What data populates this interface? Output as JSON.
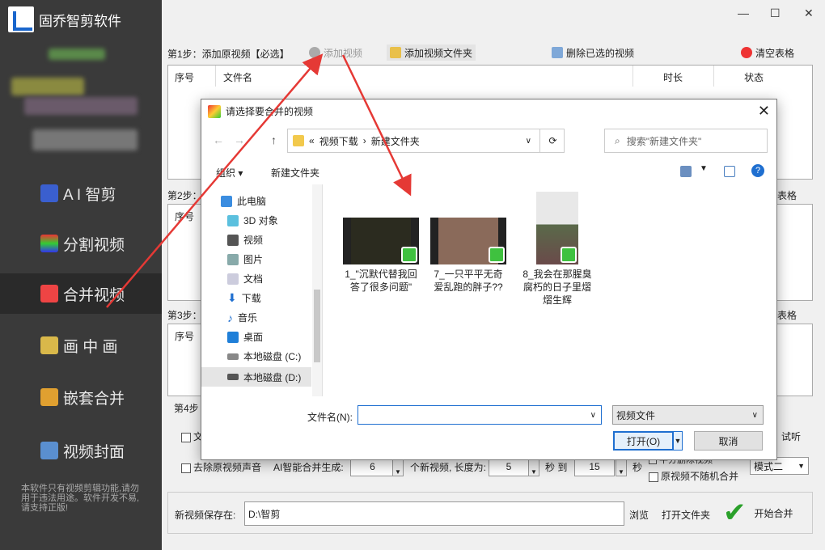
{
  "app": {
    "title": "固乔智剪软件"
  },
  "sidebar": {
    "items": [
      {
        "label": "A I 智剪",
        "active": false
      },
      {
        "label": "分割视频",
        "active": false
      },
      {
        "label": "合并视频",
        "active": true
      },
      {
        "label": "画 中 画",
        "active": false
      },
      {
        "label": "嵌套合并",
        "active": false
      },
      {
        "label": "视频封面",
        "active": false
      }
    ],
    "note": "本软件只有视频剪辑功能,请勿用于违法用途。软件开发不易,请支持正版!"
  },
  "window": {
    "minimize": "—",
    "maximize": "☐",
    "close": "✕"
  },
  "step1": {
    "label": "第1步：添加原视频【必选】",
    "add_video": "添加视频",
    "add_folder": "添加视频文件夹",
    "delete_selected": "删除已选的视频",
    "clear_table": "清空表格",
    "columns": [
      "序号",
      "文件名",
      "时长",
      "状态"
    ]
  },
  "step2": {
    "label": "第2步：",
    "col_index": "序号",
    "clear": "表格"
  },
  "step3": {
    "label": "第3步：",
    "col_index": "序号",
    "clear": "表格"
  },
  "step4": {
    "label": "第4步",
    "partial_label": "文",
    "listen": "试听",
    "remove_audio": "去除原视频声音",
    "ai_merge_label": "AI智能合并生成:",
    "count_value": "6",
    "new_video_label": "个新视频, 长度为:",
    "min_value": "5",
    "sec_to": "秒 到",
    "max_value": "15",
    "sec": "秒",
    "cutoff_label": "平分删除视频",
    "no_random": "原视频不随机合并",
    "mode": "模式二"
  },
  "save": {
    "label": "新视频保存在:",
    "path": "D:\\智剪",
    "browse": "浏览",
    "open_folder": "打开文件夹",
    "start": "开始合并"
  },
  "dialog": {
    "title": "请选择要合并的视频",
    "path_parts": [
      "«",
      "视频下载",
      "›",
      "新建文件夹"
    ],
    "search_placeholder": "搜索\"新建文件夹\"",
    "organize": "组织",
    "new_folder": "新建文件夹",
    "tree": [
      "此电脑",
      "3D 对象",
      "视频",
      "图片",
      "文档",
      "下载",
      "音乐",
      "桌面",
      "本地磁盘 (C:)",
      "本地磁盘 (D:)"
    ],
    "files": [
      {
        "name": "1_\"沉默代替我回答了很多问题\""
      },
      {
        "name": "7_一只平平无奇爱乱跑的胖子??"
      },
      {
        "name": "8_我会在那腥臭腐朽的日子里熠熠生辉"
      }
    ],
    "filename_label": "文件名(N):",
    "filename_value": "",
    "filetype": "视频文件",
    "open": "打开(O)",
    "cancel": "取消"
  },
  "colors": {
    "accent": "#1a66cc",
    "arrow": "#e53935",
    "sidebar": "#3a3a3a"
  }
}
